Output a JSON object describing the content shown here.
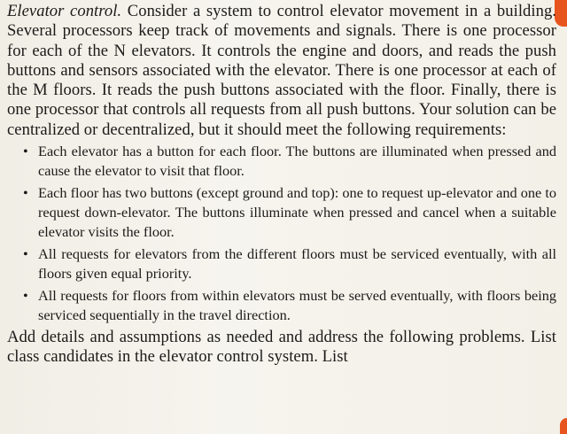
{
  "document": {
    "title": "Elevator control.",
    "intro": " Consider a system to control elevator movement in a building. Several processors keep track of movements and signals. There is one processor for each of the N elevators. It controls the engine and doors, and reads the push buttons and sensors associated with the elevator. There is one processor at each of the M floors. It reads the push buttons associated with the floor. Finally, there is one processor that controls all requests from all push buttons. Your solution can be centralized or decentralized, but it should meet the following requirements:",
    "bullet_symbol": "•",
    "requirements": [
      "Each elevator has a button for each floor. The buttons are illuminated when pressed and cause the elevator to visit that floor.",
      "Each floor has two buttons (except ground and top): one to request up-elevator and one to request down-elevator. The buttons illuminate when pressed and cancel when a suitable elevator visits the floor.",
      "All requests for elevators from the different floors must be serviced eventually, with all floors given equal priority.",
      "All requests for floors from within elevators must be served eventually, with floors being serviced sequentially in the travel direction."
    ],
    "closing": "Add details and assumptions as needed and address the following problems. List class candidates in the elevator control system. List"
  }
}
